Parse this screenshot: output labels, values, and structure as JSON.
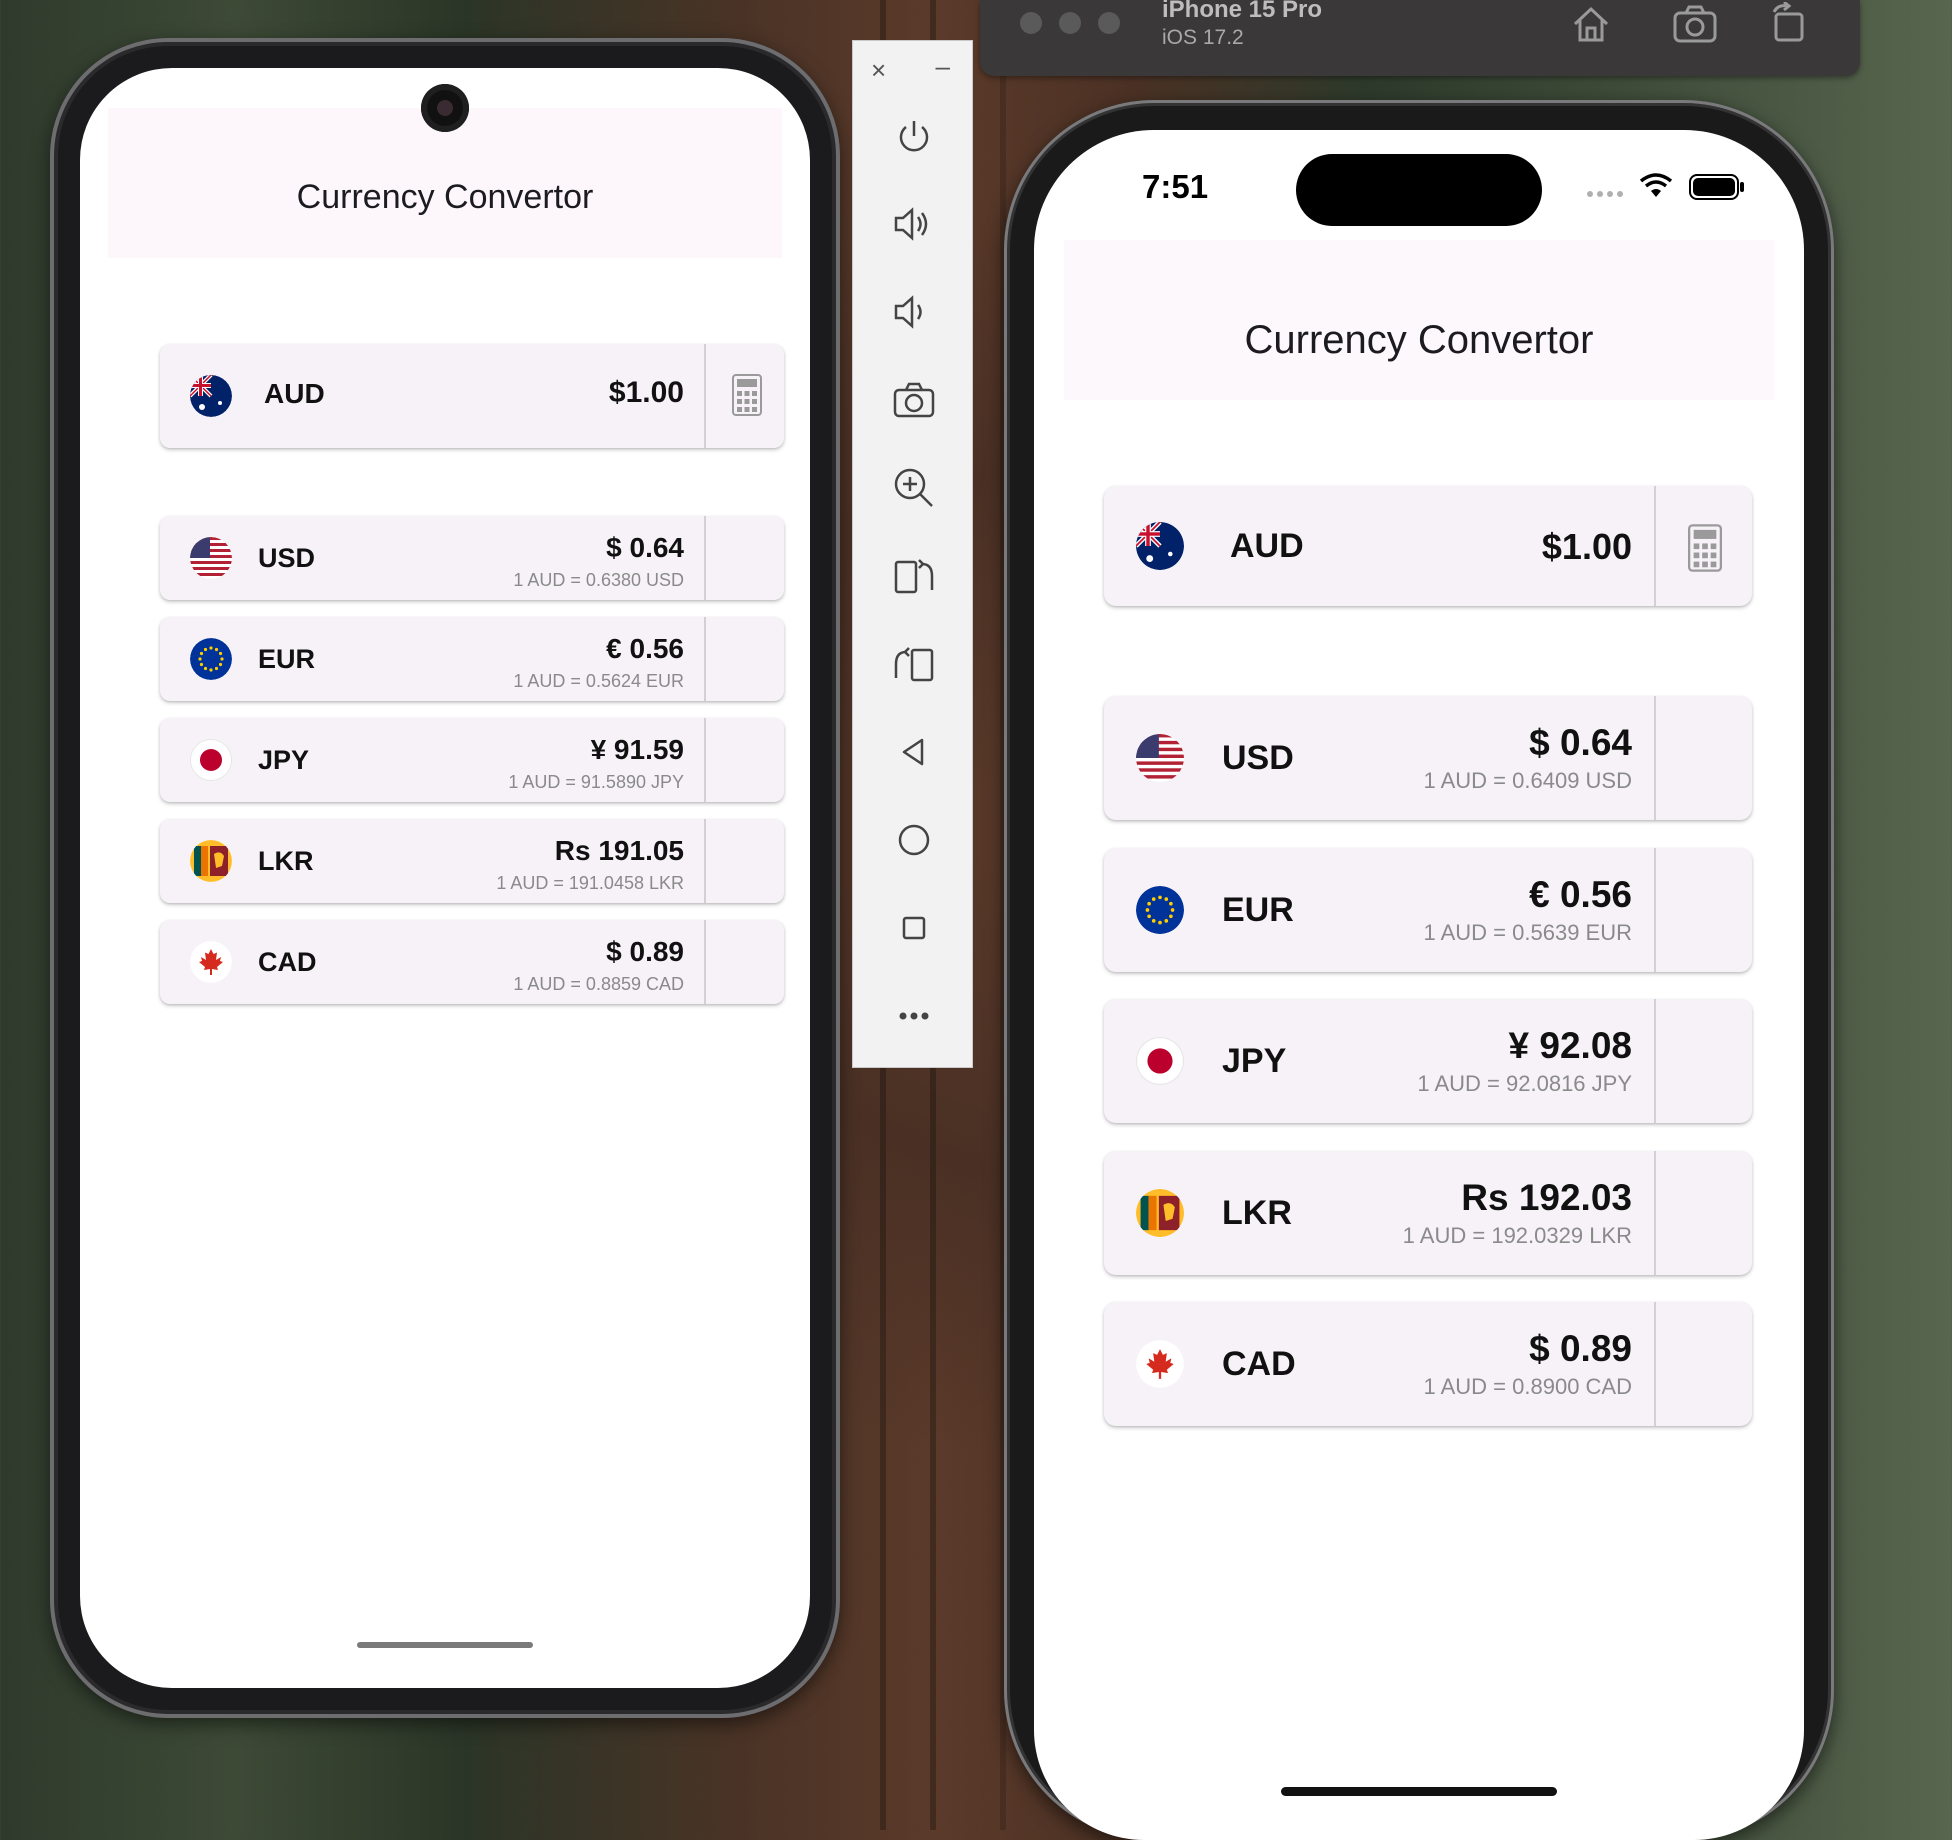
{
  "android": {
    "title": "Currency Convertor",
    "base": {
      "code": "AUD",
      "amount": "$1.00"
    },
    "rates": [
      {
        "code": "USD",
        "amount": "$ 0.64",
        "rate": "1 AUD = 0.6380 USD",
        "flag": "us-flag"
      },
      {
        "code": "EUR",
        "amount": "€ 0.56",
        "rate": "1 AUD = 0.5624 EUR",
        "flag": "eu-flag"
      },
      {
        "code": "JPY",
        "amount": "¥ 91.59",
        "rate": "1 AUD = 91.5890 JPY",
        "flag": "jp-flag"
      },
      {
        "code": "LKR",
        "amount": "Rs 191.05",
        "rate": "1 AUD = 191.0458 LKR",
        "flag": "lk-flag"
      },
      {
        "code": "CAD",
        "amount": "$ 0.89",
        "rate": "1 AUD = 0.8859 CAD",
        "flag": "ca-flag"
      }
    ]
  },
  "toolbar": {
    "close": "×",
    "minimize": "–",
    "buttons": [
      "power-icon",
      "volume-up-icon",
      "volume-down-icon",
      "camera-icon",
      "zoom-icon",
      "rotate-left-icon",
      "rotate-right-icon",
      "back-icon",
      "home-icon",
      "overview-icon",
      "more-icon"
    ]
  },
  "simulator": {
    "device": "iPhone 15 Pro",
    "os": "iOS 17.2"
  },
  "ios": {
    "time": "7:51",
    "title": "Currency Convertor",
    "base": {
      "code": "AUD",
      "amount": "$1.00"
    },
    "rates": [
      {
        "code": "USD",
        "amount": "$ 0.64",
        "rate": "1 AUD = 0.6409 USD",
        "flag": "us-flag"
      },
      {
        "code": "EUR",
        "amount": "€ 0.56",
        "rate": "1 AUD = 0.5639 EUR",
        "flag": "eu-flag"
      },
      {
        "code": "JPY",
        "amount": "¥ 92.08",
        "rate": "1 AUD = 92.0816 JPY",
        "flag": "jp-flag"
      },
      {
        "code": "LKR",
        "amount": "Rs 192.03",
        "rate": "1 AUD = 192.0329 LKR",
        "flag": "lk-flag"
      },
      {
        "code": "CAD",
        "amount": "$ 0.89",
        "rate": "1 AUD = 0.8900 CAD",
        "flag": "ca-flag"
      }
    ]
  },
  "colors": {
    "card": "#f6f2f8",
    "header": "#fdf7fb",
    "rateText": "#8a8a8a"
  }
}
